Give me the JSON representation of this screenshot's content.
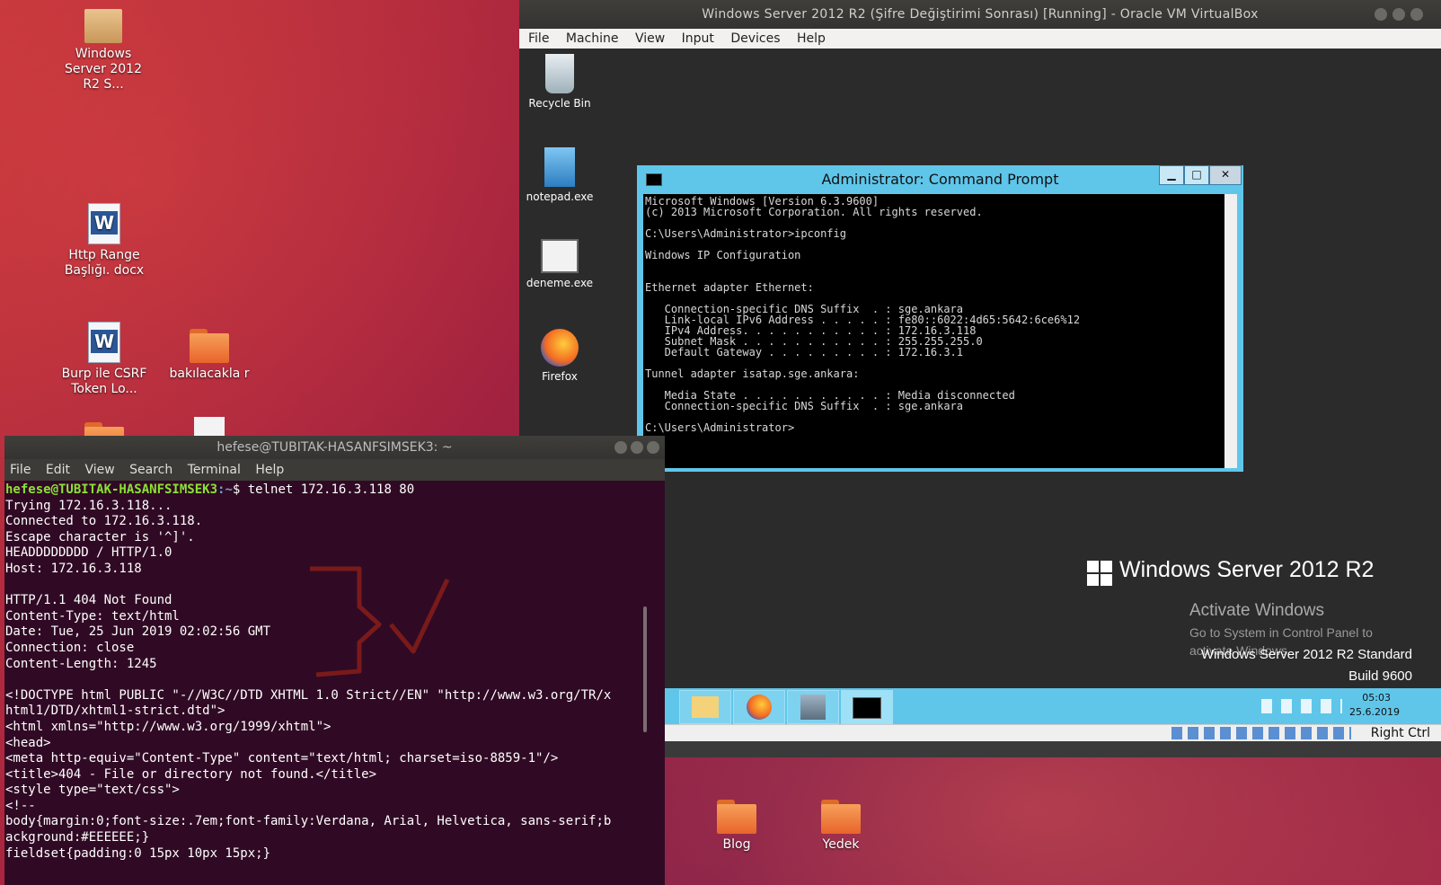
{
  "desktop": {
    "icons": [
      {
        "label": "Windows Server 2012 R2 S..."
      },
      {
        "label": "Http Range Başlığı. docx"
      },
      {
        "label": "Burp ile CSRF Token Lo..."
      },
      {
        "label": "bakılacakla r"
      },
      {
        "label": "Blog"
      },
      {
        "label": "Yedek"
      }
    ]
  },
  "vbox": {
    "title": "Windows Server 2012 R2 (Şifre Değiştirimi Sonrası) [Running] - Oracle VM VirtualBox",
    "menu": [
      "File",
      "Machine",
      "View",
      "Input",
      "Devices",
      "Help"
    ],
    "host_key": "Right Ctrl"
  },
  "guest": {
    "icons": [
      {
        "label": "Recycle Bin"
      },
      {
        "label": "notepad.exe"
      },
      {
        "label": "deneme.exe"
      },
      {
        "label": "Firefox"
      }
    ],
    "branding": "Windows Server 2012 R2",
    "activate_title": "Activate Windows",
    "activate_sub": "Go to System in Control Panel to activate Windows.",
    "edition": "Windows Server 2012 R2 Standard",
    "build": "Build 9600",
    "clock_time": "05:03",
    "clock_date": "25.6.2019"
  },
  "cmd": {
    "title": "Administrator: Command Prompt",
    "output": "Microsoft Windows [Version 6.3.9600]\n(c) 2013 Microsoft Corporation. All rights reserved.\n\nC:\\Users\\Administrator>ipconfig\n\nWindows IP Configuration\n\n\nEthernet adapter Ethernet:\n\n   Connection-specific DNS Suffix  . : sge.ankara\n   Link-local IPv6 Address . . . . . : fe80::6022:4d65:5642:6ce6%12\n   IPv4 Address. . . . . . . . . . . : 172.16.3.118\n   Subnet Mask . . . . . . . . . . . : 255.255.255.0\n   Default Gateway . . . . . . . . . : 172.16.3.1\n\nTunnel adapter isatap.sge.ankara:\n\n   Media State . . . . . . . . . . . : Media disconnected\n   Connection-specific DNS Suffix  . : sge.ankara\n\nC:\\Users\\Administrator>"
  },
  "terminal": {
    "title": "hefese@TUBITAK-HASANFSIMSEK3: ~",
    "menu": [
      "File",
      "Edit",
      "View",
      "Search",
      "Terminal",
      "Help"
    ],
    "prompt_user": "hefese@TUBITAK-HASANFSIMSEK3",
    "prompt_path": ":~",
    "command": "$ telnet 172.16.3.118 80",
    "output": "Trying 172.16.3.118...\nConnected to 172.16.3.118.\nEscape character is '^]'.\nHEADDDDDDDD / HTTP/1.0\nHost: 172.16.3.118\n\nHTTP/1.1 404 Not Found\nContent-Type: text/html\nDate: Tue, 25 Jun 2019 02:02:56 GMT\nConnection: close\nContent-Length: 1245\n\n<!DOCTYPE html PUBLIC \"-//W3C//DTD XHTML 1.0 Strict//EN\" \"http://www.w3.org/TR/x\nhtml1/DTD/xhtml1-strict.dtd\">\n<html xmlns=\"http://www.w3.org/1999/xhtml\">\n<head>\n<meta http-equiv=\"Content-Type\" content=\"text/html; charset=iso-8859-1\"/>\n<title>404 - File or directory not found.</title>\n<style type=\"text/css\">\n<!--\nbody{margin:0;font-size:.7em;font-family:Verdana, Arial, Helvetica, sans-serif;b\nackground:#EEEEEE;}\nfieldset{padding:0 15px 10px 15px;}"
  }
}
